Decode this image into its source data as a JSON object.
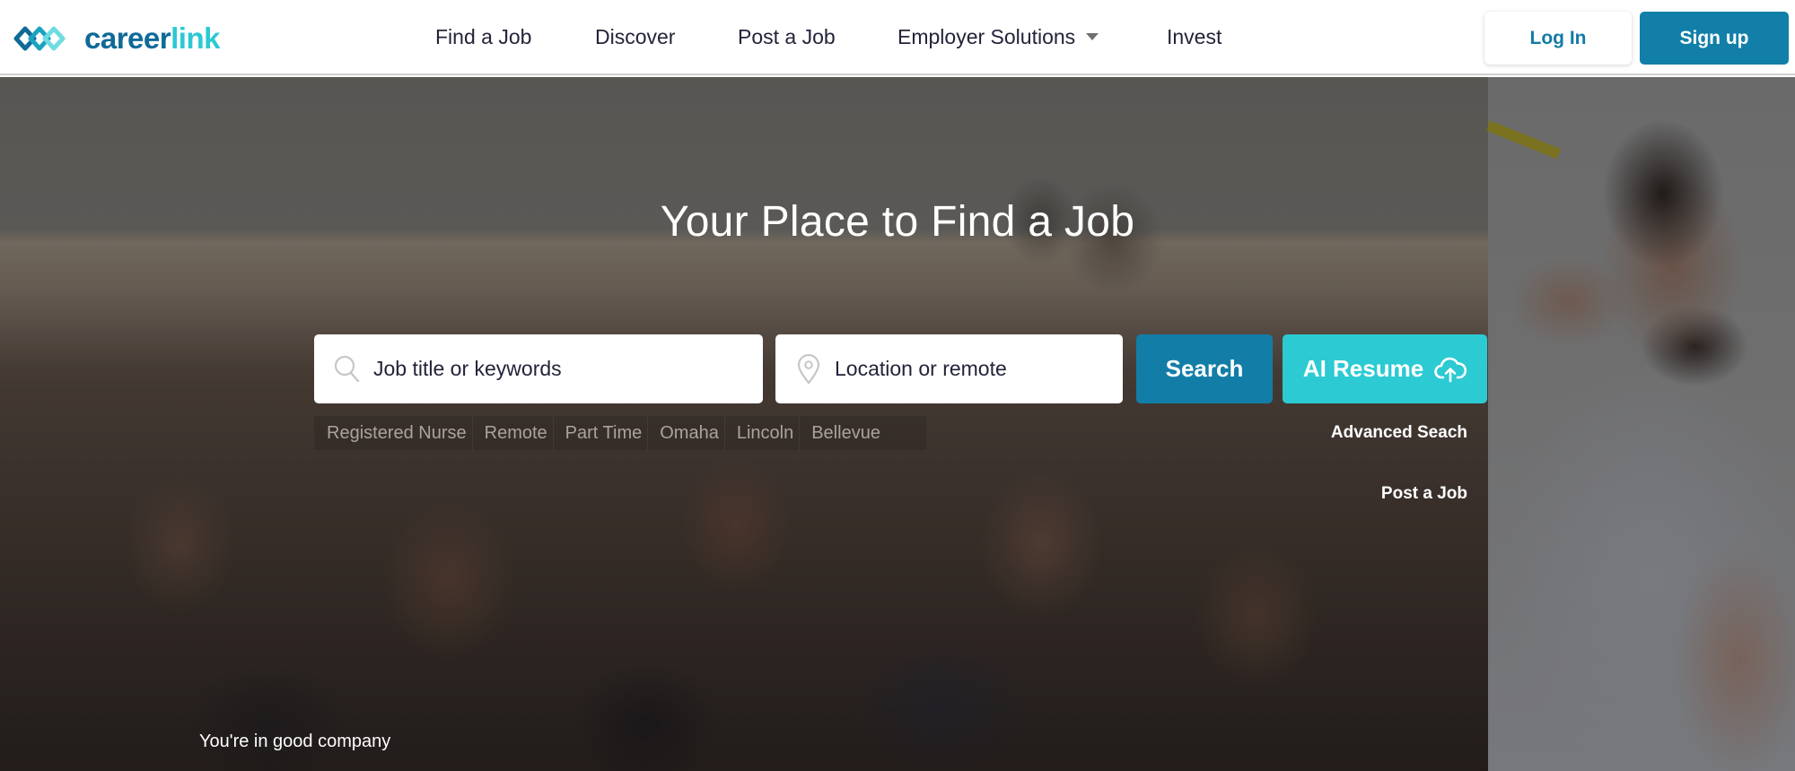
{
  "header": {
    "logo": {
      "text_part1": "career",
      "text_part2": "link",
      "icon": "chain-link-logo-icon"
    },
    "nav": [
      {
        "label": "Find a Job"
      },
      {
        "label": "Discover"
      },
      {
        "label": "Post a Job"
      },
      {
        "label": "Employer Solutions",
        "has_dropdown": true
      },
      {
        "label": "Invest"
      }
    ],
    "login_label": "Log In",
    "signup_label": "Sign up"
  },
  "hero": {
    "title": "Your Place to Find a Job",
    "job_search": {
      "placeholder": "Job title or keywords",
      "value": "",
      "icon": "search-icon"
    },
    "location_search": {
      "placeholder": "Location or remote",
      "value": "",
      "icon": "location-pin-icon"
    },
    "search_button": "Search",
    "ai_resume_button": "AI Resume",
    "ai_resume_icon": "cloud-upload-icon",
    "quick_tags": [
      "Registered Nurse",
      "Remote",
      "Part Time",
      "Omaha",
      "Lincoln",
      "Bellevue"
    ],
    "advanced_search_link": "Advanced Seach",
    "post_job_link": "Post a Job",
    "tagline": "You're in good company"
  },
  "colors": {
    "brand_dark": "#117fa8",
    "brand_light": "#2ccad3",
    "nav_text": "#23233a"
  }
}
